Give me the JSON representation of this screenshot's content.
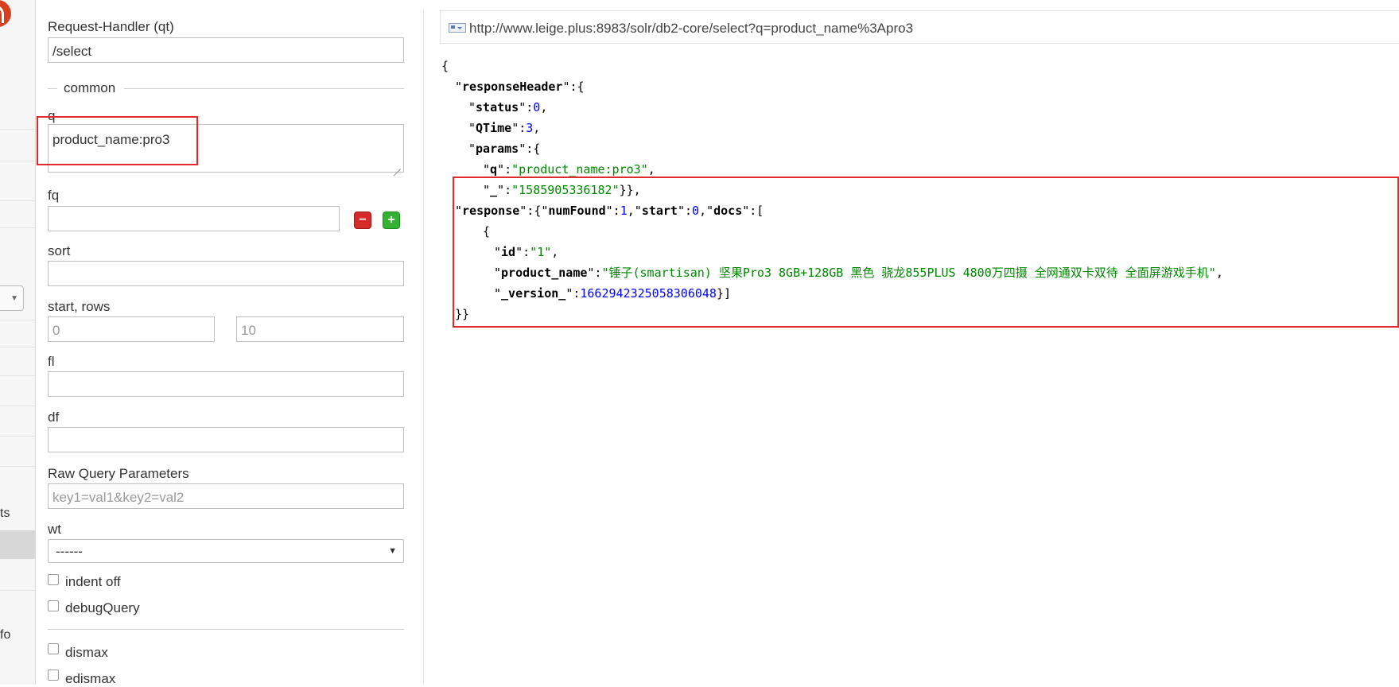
{
  "nav": {
    "partial_labels": [
      "ts",
      "fo"
    ]
  },
  "form": {
    "request_handler": {
      "label": "Request-Handler (qt)",
      "value": "/select"
    },
    "common_legend": "common",
    "q": {
      "label": "q",
      "value": "product_name:pro3"
    },
    "fq": {
      "label": "fq",
      "value": ""
    },
    "sort": {
      "label": "sort",
      "value": ""
    },
    "start_rows": {
      "label": "start, rows",
      "start_placeholder": "0",
      "rows_placeholder": "10"
    },
    "fl": {
      "label": "fl",
      "value": ""
    },
    "df": {
      "label": "df",
      "value": ""
    },
    "raw_params": {
      "label": "Raw Query Parameters",
      "placeholder": "key1=val1&key2=val2"
    },
    "wt": {
      "label": "wt",
      "selected": "------"
    },
    "checkboxes": [
      "indent off",
      "debugQuery",
      "dismax",
      "edismax"
    ]
  },
  "result": {
    "url": "http://www.leige.plus:8983/solr/db2-core/select?q=product_name%3Apro3",
    "json": {
      "open_brace": "{",
      "responseHeader_key": "responseHeader",
      "status_key": "status",
      "status_val": "0",
      "qtime_key": "QTime",
      "qtime_val": "3",
      "params_key": "params",
      "q_key": "q",
      "q_val": "product_name:pro3",
      "underscore_key": "_",
      "underscore_val": "1585905336182",
      "response_key": "response",
      "numfound_key": "numFound",
      "numfound_val": "1",
      "start_key": "start",
      "start_val": "0",
      "docs_key": "docs",
      "doc_open": "{",
      "id_key": "id",
      "id_val": "1",
      "product_name_key": "product_name",
      "product_name_val": "锤子(smartisan) 坚果Pro3 8GB+128GB 黑色 骁龙855PLUS 4800万四摄 全网通双卡双待 全面屏游戏手机",
      "version_key": "_version_",
      "version_val": "1662942325058306048",
      "close": "}}"
    }
  },
  "colors": {
    "highlight": "#e0292b",
    "string": "#008800",
    "number": "#0000ff"
  }
}
